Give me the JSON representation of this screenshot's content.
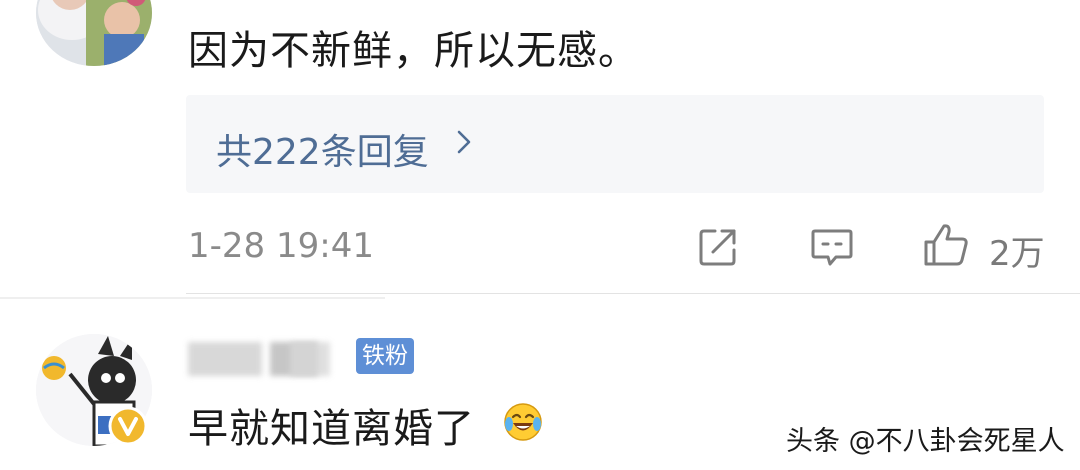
{
  "comment1": {
    "text": "因为不新鲜，所以无感。",
    "replies_label": "共222条回复",
    "timestamp": "1-28 19:41",
    "like_count": "2万"
  },
  "comment2": {
    "badge": "铁粉",
    "text": "早就知道离婚了"
  },
  "watermark": "头条 @不八卦会死星人",
  "icons": [
    "share-icon",
    "comment-icon",
    "like-icon",
    "chevron-right-icon",
    "laugh-cry-emoji-icon",
    "verified-v-icon"
  ],
  "colors": {
    "link": "#4f6d95",
    "badge": "#5e8fd6",
    "verified": "#f1b82d",
    "muted": "#8a8a8a"
  }
}
